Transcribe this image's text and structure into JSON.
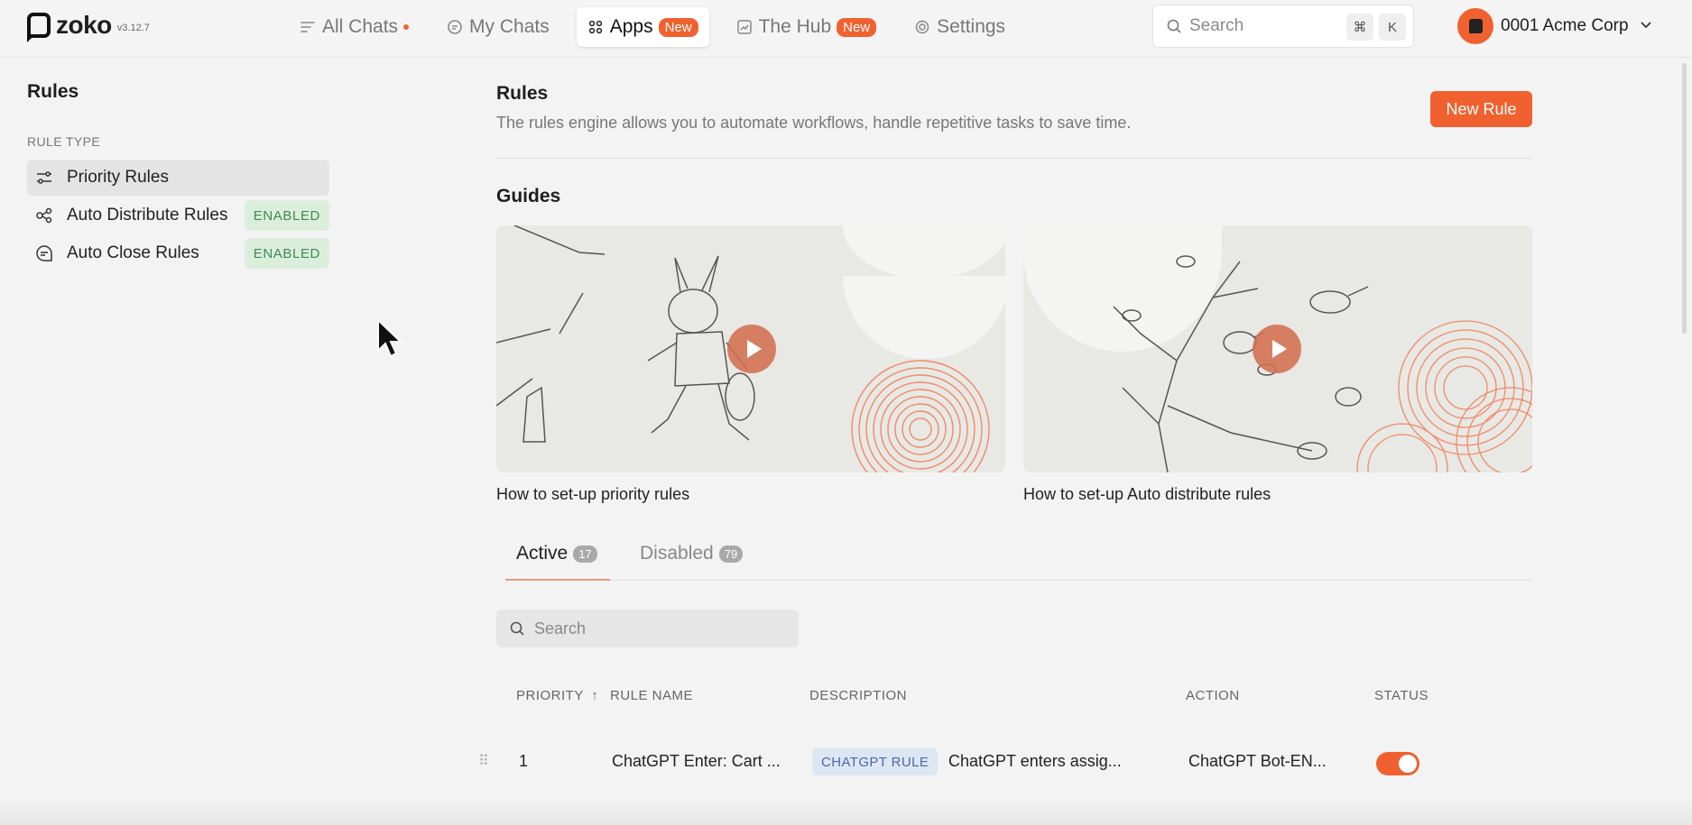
{
  "app": {
    "name": "zoko",
    "version": "v3.12.7"
  },
  "nav": {
    "items": [
      {
        "label": "All Chats",
        "icon": "list-filter-icon",
        "has_dot": true
      },
      {
        "label": "My Chats",
        "icon": "chat-bubble-icon"
      },
      {
        "label": "Apps",
        "icon": "grid-icon",
        "badge": "New",
        "active": true
      },
      {
        "label": "The Hub",
        "icon": "chart-icon",
        "badge": "New"
      },
      {
        "label": "Settings",
        "icon": "gear-icon"
      }
    ],
    "search_placeholder": "Search",
    "shortcut_keys": [
      "⌘",
      "K"
    ],
    "account_name": "0001 Acme Corp"
  },
  "sidebar": {
    "title": "Rules",
    "section_label": "RULE TYPE",
    "items": [
      {
        "label": "Priority Rules",
        "icon": "sliders-icon",
        "active": true
      },
      {
        "label": "Auto Distribute Rules",
        "icon": "share-nodes-icon",
        "status": "ENABLED"
      },
      {
        "label": "Auto Close Rules",
        "icon": "chat-close-icon",
        "status": "ENABLED"
      }
    ]
  },
  "main": {
    "title": "Rules",
    "subtitle": "The rules engine allows you to automate workflows, handle repetitive tasks to save time.",
    "new_rule_label": "New Rule",
    "guides_title": "Guides",
    "guides": [
      {
        "caption": "How to set-up priority rules"
      },
      {
        "caption": "How to set-up Auto distribute rules"
      }
    ],
    "tabs": [
      {
        "label": "Active",
        "count": "17",
        "active": true
      },
      {
        "label": "Disabled",
        "count": "79"
      }
    ],
    "table_search_placeholder": "Search",
    "columns": {
      "priority": "PRIORITY",
      "rule_name": "RULE NAME",
      "description": "DESCRIPTION",
      "action": "ACTION",
      "status": "STATUS"
    },
    "rows": [
      {
        "priority": "1",
        "rule_name": "ChatGPT Enter: Cart ...",
        "tag": "CHATGPT RULE",
        "description": "ChatGPT enters assig...",
        "action": "ChatGPT Bot-EN...",
        "enabled": true
      }
    ]
  },
  "colors": {
    "accent": "#f0612f",
    "enabled_bg": "#dbeedc",
    "enabled_text": "#3f8a52",
    "chip_bg": "#dde6f3",
    "chip_text": "#4b6aa4"
  }
}
